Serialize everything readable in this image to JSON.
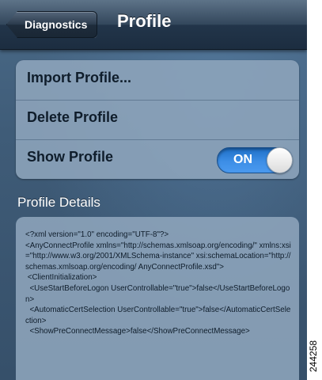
{
  "navbar": {
    "back_label": "Diagnostics",
    "title": "Profile"
  },
  "menu": {
    "items": [
      {
        "label": "Import Profile..."
      },
      {
        "label": "Delete Profile"
      },
      {
        "label": "Show Profile"
      }
    ],
    "toggle_text": "ON"
  },
  "details": {
    "section_title": "Profile Details",
    "content": "<?xml version=\"1.0\" encoding=\"UTF-8\"?>\n<AnyConnectProfile xmlns=\"http://schemas.xmlsoap.org/encoding/\" xmlns:xsi=\"http://www.w3.org/2001/XMLSchema-instance\" xsi:schemaLocation=\"http://schemas.xmlsoap.org/encoding/ AnyConnectProfile.xsd\">\n <ClientInitialization>\n  <UseStartBeforeLogon UserControllable=\"true\">false</UseStartBeforeLogon>\n  <AutomaticCertSelection UserControllable=\"true\">false</AutomaticCertSelection>\n  <ShowPreConnectMessage>false</ShowPreConnectMessage>"
  },
  "figure_id": "244258"
}
